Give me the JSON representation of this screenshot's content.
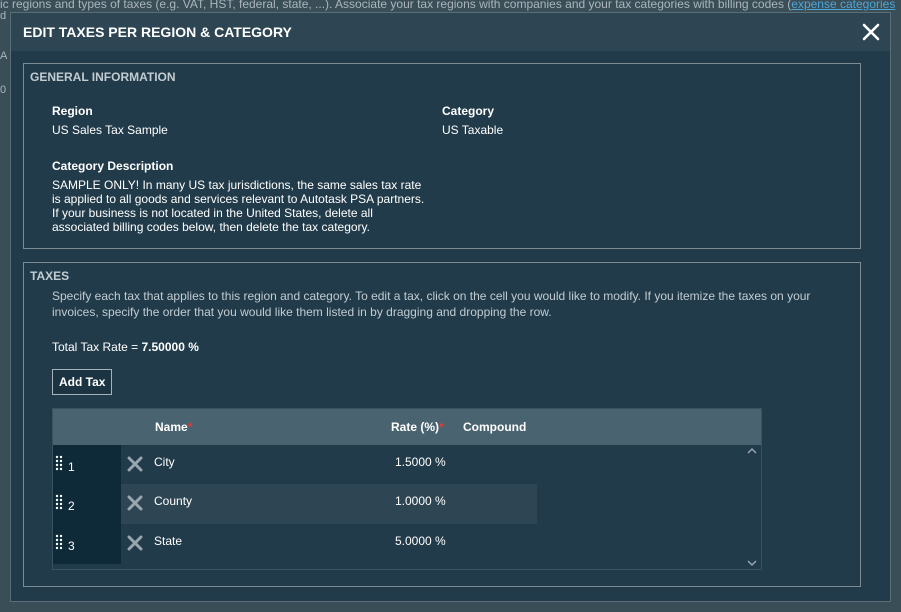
{
  "background": {
    "top_text": "ic regions and types of taxes (e.g. VAT, HST, federal, state, ...). Associate your tax regions with companies and your tax categories with billing codes (",
    "top_link": "expense categories",
    "left_fragments": [
      "d",
      "A",
      "0"
    ]
  },
  "dialog": {
    "title": "EDIT TAXES PER REGION & CATEGORY"
  },
  "general": {
    "title": "GENERAL INFORMATION",
    "region_label": "Region",
    "region_value": "US Sales Tax Sample",
    "category_label": "Category",
    "category_value": "US Taxable",
    "description_label": "Category Description",
    "description_value": "SAMPLE ONLY! In many US tax jurisdictions, the same sales tax rate is applied to all goods and services relevant to Autotask PSA partners. If your business is not located in the United States, delete all associated billing codes below, then delete the tax category."
  },
  "taxes": {
    "title": "TAXES",
    "instructions": "Specify each tax that applies to this region and category. To edit a tax, click on the cell you would like to modify. If you itemize the taxes on your invoices, specify the order that you would like them listed in by dragging and dropping the row.",
    "total_label": "Total Tax Rate = ",
    "total_value": "7.50000 %",
    "add_button": "Add Tax",
    "columns": {
      "name": "Name",
      "rate": "Rate (%)",
      "compound": "Compound",
      "required_mark": "*"
    },
    "rows": [
      {
        "order": "1",
        "name": "City",
        "rate": "1.5000 %"
      },
      {
        "order": "2",
        "name": "County",
        "rate": "1.0000 %"
      },
      {
        "order": "3",
        "name": "State",
        "rate": "5.0000 %"
      }
    ]
  },
  "colors": {
    "dialog_bg": "#213b4a",
    "header_bg": "#2e4654",
    "grid_header_bg": "#4a6370",
    "required": "#e03a3a",
    "link": "#4da6d8"
  },
  "icons": {
    "close": "close-icon",
    "delete": "delete-x-icon",
    "drag": "drag-handle-icon",
    "scroll_up": "chevron-up-icon",
    "scroll_down": "chevron-down-icon"
  }
}
